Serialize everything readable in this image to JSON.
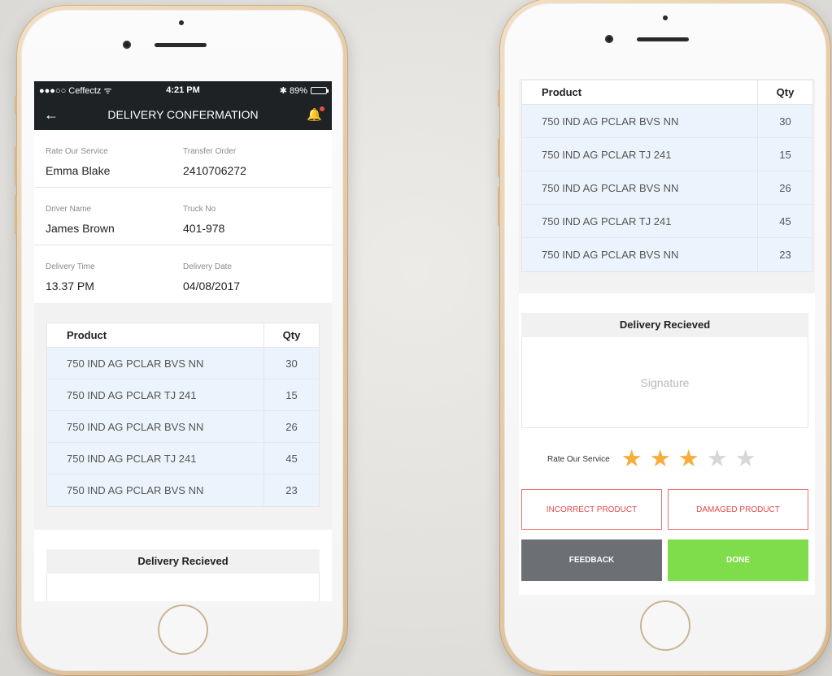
{
  "left_screen": {
    "status_bar": {
      "carrier": "●●●○○ Ceffectz ᯤ",
      "time": "4:21 PM",
      "battery": "✱ 89%",
      "battery_level": 0.89
    },
    "nav": {
      "back_icon": "arrow-left-icon",
      "title": "DELIVERY CONFERMATION",
      "bell_icon": "bell-icon"
    },
    "info": [
      {
        "left_label": "Rate Our Service",
        "left_value": "Emma Blake",
        "right_label": "Transfer Order",
        "right_value": "2410706272"
      },
      {
        "left_label": "Driver Name",
        "left_value": "James Brown",
        "right_label": "Truck No",
        "right_value": "401-978"
      },
      {
        "left_label": "Delivery Time",
        "left_value": "13.37 PM",
        "right_label": "Delivery Date",
        "right_value": "04/08/2017"
      }
    ],
    "table": {
      "headers": [
        "Product",
        "Qty"
      ],
      "rows": [
        [
          "750 IND AG PCLAR BVS NN",
          "30"
        ],
        [
          "750 IND AG PCLAR TJ 241",
          "15"
        ],
        [
          "750 IND AG PCLAR BVS NN",
          "26"
        ],
        [
          "750 IND AG PCLAR TJ 241",
          "45"
        ],
        [
          "750 IND AG PCLAR BVS NN",
          "23"
        ]
      ]
    },
    "delivery_received": "Delivery Recieved"
  },
  "right_screen": {
    "table": {
      "headers": [
        "Product",
        "Qty"
      ],
      "rows": [
        [
          "750 IND AG PCLAR BVS NN",
          "30"
        ],
        [
          "750 IND AG PCLAR TJ 241",
          "15"
        ],
        [
          "750 IND AG PCLAR BVS NN",
          "26"
        ],
        [
          "750 IND AG PCLAR TJ 241",
          "45"
        ],
        [
          "750 IND AG PCLAR BVS NN",
          "23"
        ]
      ]
    },
    "delivery_received": "Delivery Recieved",
    "signature_placeholder": "Signature",
    "rating": {
      "label": "Rate Our Service",
      "value": 3,
      "max": 5
    },
    "buttons": {
      "incorrect": "INCORRECT PRODUCT",
      "damaged": "DAMAGED PRODUCT",
      "feedback": "FEEDBACK",
      "done": "DONE"
    }
  },
  "colors": {
    "nav_bg": "#1f2225",
    "row_bg": "#ebf4fc",
    "star_on": "#f6ad3b",
    "star_off": "#d7d7d7",
    "danger": "#e34a4a",
    "feedback_bg": "#6c6f74",
    "done_bg": "#7fdc4b"
  }
}
